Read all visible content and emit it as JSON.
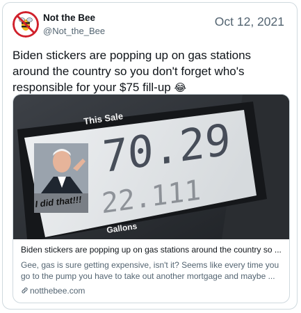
{
  "account": {
    "display_name": "Not the Bee",
    "handle": "@Not_the_Bee",
    "avatar_icon": "no-bee-logo-icon"
  },
  "date": "Oct 12, 2021",
  "tweet": {
    "text": "Biden stickers are popping up on gas stations around the country so you don't forget who's responsible for your $75 fill-up",
    "emoji": "😂"
  },
  "card": {
    "image": {
      "top_label": "This Sale",
      "price": "70.29",
      "gallons_reading": "22.111",
      "bottom_label": "Gallons",
      "sticker_text": "I did that!!!"
    },
    "title": "Biden stickers are popping up on gas stations around the country so ...",
    "description": "Gee, gas is sure getting expensive, isn't it? Seems like every time you go to the pump you have to take out another mortgage and maybe ...",
    "domain": "notthebee.com",
    "link_icon": "link-icon"
  },
  "colors": {
    "text": "#0f1419",
    "secondary": "#536471",
    "border": "#cfd9de",
    "logo_red": "#d0202b",
    "logo_yellow": "#f2b81d"
  }
}
